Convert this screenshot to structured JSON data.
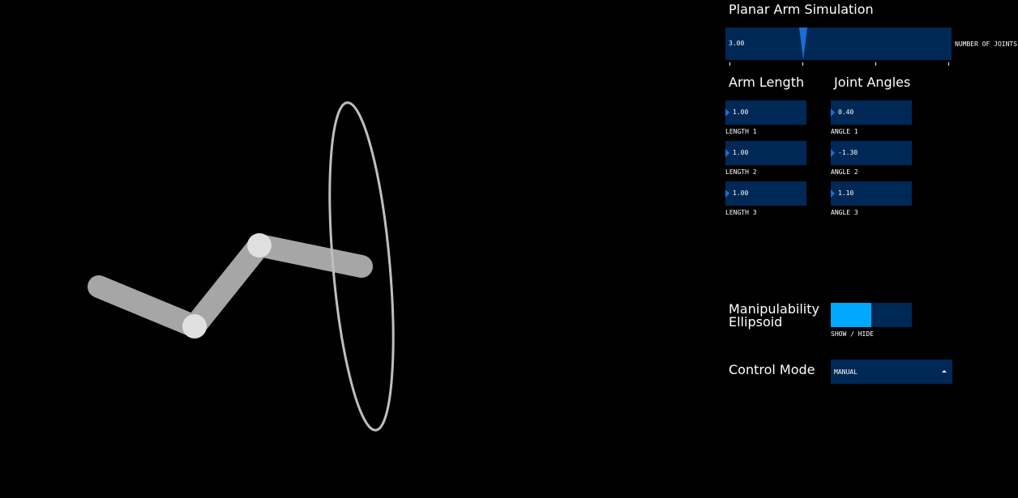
{
  "title": "Planar Arm Simulation",
  "joints_slider": {
    "value": "3.00",
    "label": "NUMBER OF JOINTS",
    "level": 0.34
  },
  "arm_length": {
    "header": "Arm Length",
    "items": [
      {
        "value": "1.00",
        "label": "LENGTH 1"
      },
      {
        "value": "1.00",
        "label": "LENGTH 2"
      },
      {
        "value": "1.00",
        "label": "LENGTH 3"
      }
    ]
  },
  "joint_angles": {
    "header": "Joint Angles",
    "items": [
      {
        "value": "0.40",
        "label": "ANGLE 1"
      },
      {
        "value": "-1.30",
        "label": "ANGLE 2"
      },
      {
        "value": "1.10",
        "label": "ANGLE 3"
      }
    ]
  },
  "manipulability": {
    "header_line1": "Manipulability",
    "header_line2": "Ellipsoid",
    "toggle_label": "SHOW / HIDE",
    "state": "show"
  },
  "control_mode": {
    "header": "Control Mode",
    "value": "MANUAL"
  },
  "colors": {
    "background": "#000000",
    "control_bg": "#002856",
    "accent": "#1a6fd6",
    "toggle_on": "#00a8ff",
    "arm": "#a6a6a6",
    "joint": "#e0e0e0",
    "ellipse": "#bfbfbf"
  },
  "icons": {
    "slider_handle": "triangle-handle-icon",
    "dropdown": "caret-up-icon",
    "numbox": "triangle-right-icon"
  }
}
